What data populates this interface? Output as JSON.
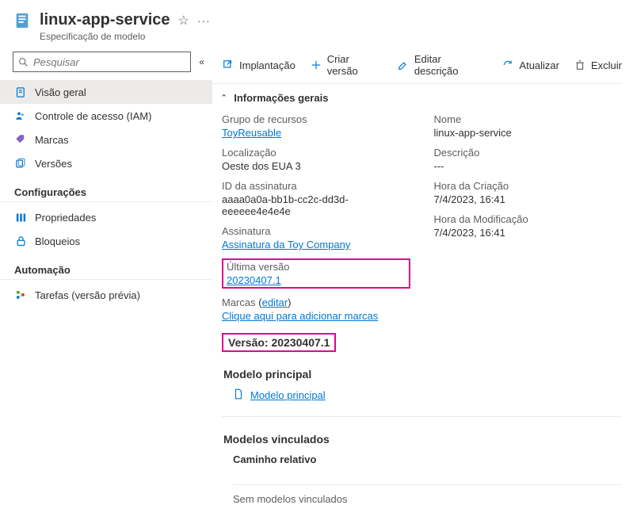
{
  "header": {
    "title": "linux-app-service",
    "subtitle": "Especificação de modelo"
  },
  "search": {
    "placeholder": "Pesquisar"
  },
  "sidebar": {
    "items": [
      {
        "label": "Visão geral"
      },
      {
        "label": "Controle de acesso (IAM)"
      },
      {
        "label": "Marcas"
      },
      {
        "label": "Versões"
      }
    ],
    "config_heading": "Configurações",
    "config_items": [
      {
        "label": "Propriedades"
      },
      {
        "label": "Bloqueios"
      }
    ],
    "auto_heading": "Automação",
    "auto_items": [
      {
        "label": "Tarefas (versão prévia)"
      }
    ]
  },
  "toolbar": {
    "deploy": "Implantação",
    "create_version": "Criar versão",
    "edit_desc": "Editar descrição",
    "refresh": "Atualizar",
    "delete": "Excluir"
  },
  "section_general": "Informações gerais",
  "props_left": {
    "rg_label": "Grupo de recursos",
    "rg_value": "ToyReusable",
    "loc_label": "Localização",
    "loc_value": "Oeste dos EUA 3",
    "subid_label": "ID da assinatura",
    "subid_value": "aaaa0a0a-bb1b-cc2c-dd3d-eeeeee4e4e4e",
    "sub_label": "Assinatura",
    "sub_value": "Assinatura da Toy Company",
    "lastver_label": "Última versão",
    "lastver_value": "20230407.1",
    "tags_label": "Marcas",
    "tags_edit": "editar",
    "tags_value": "Clique aqui para adicionar marcas"
  },
  "props_right": {
    "name_label": "Nome",
    "name_value": "linux-app-service",
    "desc_label": "Descrição",
    "desc_value": "---",
    "created_label": "Hora da Criação",
    "created_value": "7/4/2023, 16:41",
    "modified_label": "Hora da Modificação",
    "modified_value": "7/4/2023, 16:41"
  },
  "version_section": {
    "heading": "Versão: 20230407.1",
    "main_model_heading": "Modelo principal",
    "main_model_link": "Modelo principal",
    "linked_heading": "Modelos vinculados",
    "rel_path_label": "Caminho relativo",
    "no_linked": "Sem modelos vinculados"
  }
}
